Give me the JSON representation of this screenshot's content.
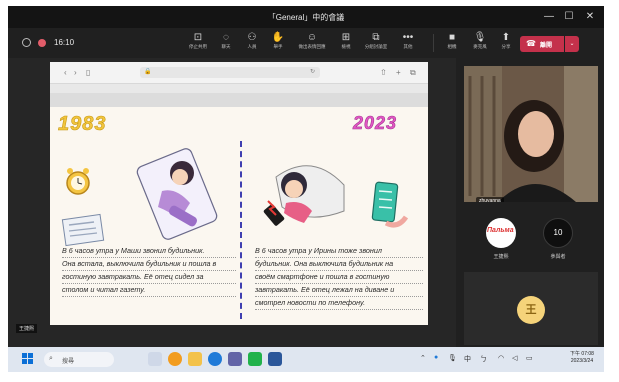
{
  "window": {
    "title": "「General」中的會議"
  },
  "window_controls": {
    "minimize": "—",
    "maximize": "☐",
    "close": "✕"
  },
  "meeting": {
    "timer": "16:10"
  },
  "toolbar": {
    "items": [
      {
        "label": "停止共用",
        "icon": "share-icon"
      },
      {
        "label": "聊天",
        "icon": "chat-icon"
      },
      {
        "label": "人員",
        "icon": "people-icon"
      },
      {
        "label": "舉手",
        "icon": "raise-hand-icon"
      },
      {
        "label": "做出表情回應",
        "icon": "reactions-icon"
      },
      {
        "label": "檢視",
        "icon": "view-icon"
      },
      {
        "label": "分組討論室",
        "icon": "breakout-rooms-icon"
      },
      {
        "label": "其他",
        "icon": "more-icon"
      },
      {
        "label": "相機",
        "icon": "camera-icon"
      },
      {
        "label": "麥克風",
        "icon": "mic-off-icon"
      },
      {
        "label": "分享",
        "icon": "share-screen-icon"
      }
    ],
    "leave_label": "離開"
  },
  "browser": {
    "url": ""
  },
  "slide": {
    "year_left": "1983",
    "year_right": "2023",
    "story_left": [
      "В 6 часов утра у Маши звонил будильник.",
      "Она встала, выключила будильник и пошла в",
      "гостиную завтракать. Её отец сидел за",
      "столом и читал газету."
    ],
    "story_right": [
      "В 6 часов утра у Ирины тоже звонил",
      "будильник. Она выключила будильник на",
      "своём смартфоне и пошла в гостиную",
      "завтракать. Её отец лежал на диване и",
      "смотрел новости по телефону."
    ]
  },
  "participants": {
    "video_name": "zhuyanna",
    "tile1_name": "王捷熙",
    "tile2_name": "參與者",
    "count": "10",
    "self_initial": "王",
    "self_name": "王捷熙"
  },
  "taskbar": {
    "search_label": "搜尋",
    "tray_lang": "中",
    "time": "下午 07:08",
    "date": "2023/3/24"
  },
  "colors": {
    "leave": "#c4314b",
    "accent": "#6264a7",
    "year_left": "#f2c53d",
    "year_right": "#e357c5"
  }
}
